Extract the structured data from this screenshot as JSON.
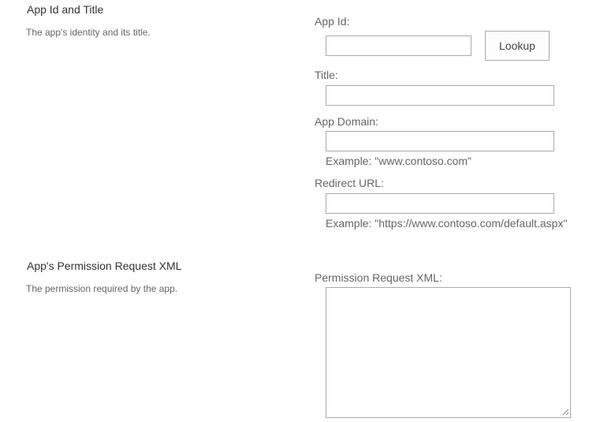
{
  "app_section": {
    "title": "App Id and Title",
    "description": "The app's identity and its title.",
    "app_id": {
      "label": "App Id:",
      "value": "",
      "lookup_label": "Lookup"
    },
    "title_field": {
      "label": "Title:",
      "value": ""
    },
    "app_domain": {
      "label": "App Domain:",
      "value": "",
      "example": "Example: \"www.contoso.com\""
    },
    "redirect_url": {
      "label": "Redirect URL:",
      "value": "",
      "example": "Example: \"https://www.contoso.com/default.aspx\""
    }
  },
  "permission_section": {
    "title": "App's Permission Request XML",
    "description": "The permission required by the app.",
    "xml": {
      "label": "Permission Request XML:",
      "value": ""
    }
  },
  "colors": {
    "border": "#ababab",
    "label_text": "#666666",
    "title_text": "#333333"
  },
  "icons": {
    "resize_grip": "resize-grip-icon"
  }
}
